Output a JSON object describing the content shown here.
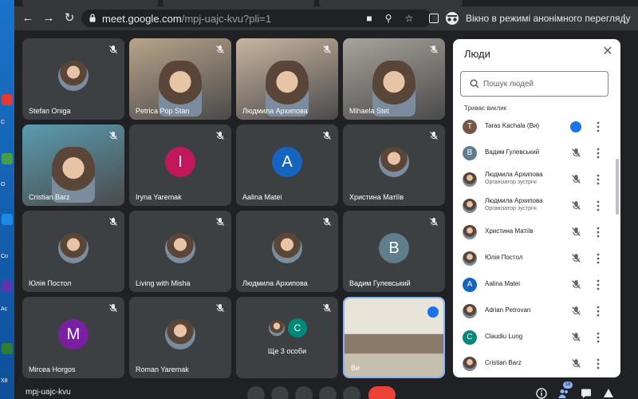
{
  "browser": {
    "url_host": "meet.google.com",
    "url_path": "/mpj-uajc-kvu?pli=1",
    "incognito_label": "Вікно в режимі анонімного перегляду"
  },
  "desktop": {
    "labels": [
      "C",
      "O",
      "Co",
      "Ac",
      "X8"
    ]
  },
  "tiles": [
    {
      "name": "Stefan Oniga",
      "kind": "photo",
      "bg": "#3c4043"
    },
    {
      "name": "Petrica Pop Stan",
      "kind": "video",
      "bg": "#b8a48a"
    },
    {
      "name": "Людмила Архипова",
      "kind": "video",
      "bg": "#c9b5a0"
    },
    {
      "name": "Mihaela Stet",
      "kind": "video",
      "bg": "#a8a39c"
    },
    {
      "name": "Cristian Barz",
      "kind": "video",
      "bg": "#5a9cb0"
    },
    {
      "name": "Iryna Yaremak",
      "kind": "letter",
      "letter": "I",
      "color": "#c2185b"
    },
    {
      "name": "Aalina Matei",
      "kind": "letter",
      "letter": "A",
      "color": "#1565c0"
    },
    {
      "name": "Христина Матіїв",
      "kind": "photo"
    },
    {
      "name": "Юлія Постол",
      "kind": "photo"
    },
    {
      "name": "Living with Misha",
      "kind": "photo"
    },
    {
      "name": "Людмила Архипова",
      "kind": "photo"
    },
    {
      "name": "Вадим Гулевський",
      "kind": "letter",
      "letter": "B",
      "color": "#607d8b"
    },
    {
      "name": "Mircea Horgos",
      "kind": "letter",
      "letter": "M",
      "color": "#7b1fa2"
    },
    {
      "name": "Roman Yaremak",
      "kind": "photo"
    },
    {
      "name": "Ще 3 особи",
      "kind": "group",
      "letter": "C",
      "color": "#00897b"
    },
    {
      "name": "Ви",
      "kind": "self",
      "bg": "#d9d2c2"
    }
  ],
  "people_panel": {
    "title": "Люди",
    "search_placeholder": "Пошук людей",
    "section_label": "Триває виклик",
    "participants": [
      {
        "name": "Taras Kachala (Ви)",
        "role": "",
        "avatar": "letter",
        "letter": "T",
        "color": "#795548",
        "speaking": true
      },
      {
        "name": "Вадим Гулевський",
        "role": "",
        "avatar": "letter",
        "letter": "B",
        "color": "#607d8b",
        "speaking": false
      },
      {
        "name": "Людмила Архипова",
        "role": "Організатор зустрічі",
        "avatar": "photo",
        "speaking": false
      },
      {
        "name": "Людмила Архипова",
        "role": "Організатор зустрічі",
        "avatar": "photo",
        "speaking": false
      },
      {
        "name": "Христина Матіїв",
        "role": "",
        "avatar": "photo",
        "speaking": false
      },
      {
        "name": "Юлія Постол",
        "role": "",
        "avatar": "photo",
        "speaking": false
      },
      {
        "name": "Aalina Matei",
        "role": "",
        "avatar": "letter",
        "letter": "A",
        "color": "#1565c0",
        "speaking": false
      },
      {
        "name": "Adrian Petrovan",
        "role": "",
        "avatar": "photo",
        "speaking": false
      },
      {
        "name": "Claudiu Lung",
        "role": "",
        "avatar": "letter",
        "letter": "C",
        "color": "#00897b",
        "speaking": false
      },
      {
        "name": "Cristian Barz",
        "role": "",
        "avatar": "photo",
        "speaking": false
      }
    ]
  },
  "bottom_bar": {
    "meeting_code": "mpj-uajc-kvu",
    "people_count": "18"
  }
}
